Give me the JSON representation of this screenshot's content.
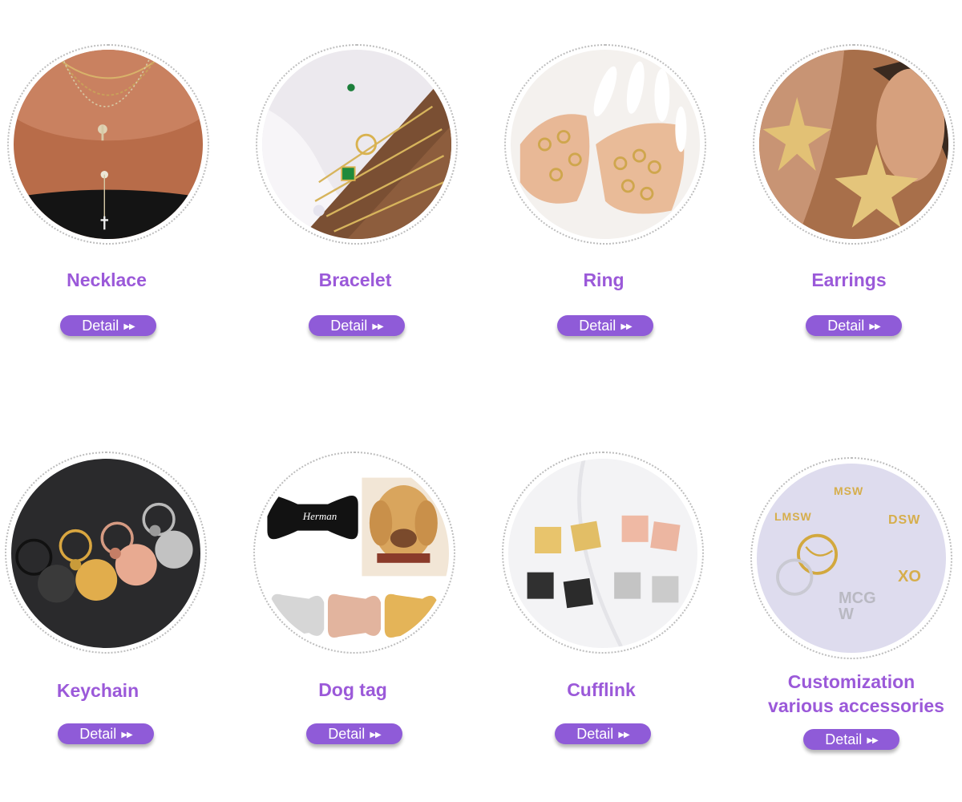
{
  "accent": "#9b59d9",
  "button_color": "#8f5bd8",
  "detail_label": "Detail",
  "arrow_icon": "double-chevron-right-icon",
  "categories": [
    {
      "title": "Necklace"
    },
    {
      "title": "Bracelet"
    },
    {
      "title": "Ring"
    },
    {
      "title": "Earrings"
    },
    {
      "title": "Keychain"
    },
    {
      "title": "Dog tag",
      "tag_text": "Herman"
    },
    {
      "title": "Cufflink"
    },
    {
      "title": "Customization",
      "title_line2": "various accessories",
      "logo_text": [
        "LMSW",
        "MSW",
        "DSW",
        "MCGW",
        "XO"
      ]
    }
  ]
}
